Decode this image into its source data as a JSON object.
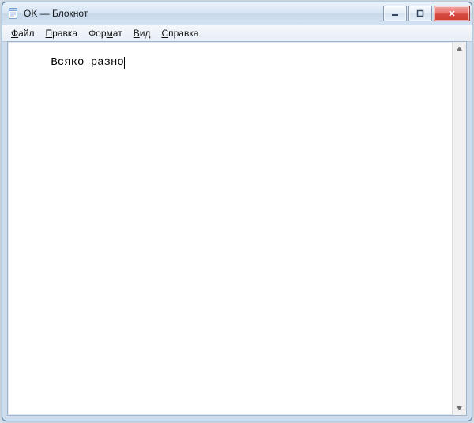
{
  "window": {
    "title": "OK — Блокнот"
  },
  "menu": {
    "file": {
      "label": "Файл",
      "accel_index": 0
    },
    "edit": {
      "label": "Правка",
      "accel_index": 0
    },
    "format": {
      "label": "Формат",
      "accel_index": 3
    },
    "view": {
      "label": "Вид",
      "accel_index": 0
    },
    "help": {
      "label": "Справка",
      "accel_index": 0
    }
  },
  "editor": {
    "content": "Всяко разно"
  }
}
